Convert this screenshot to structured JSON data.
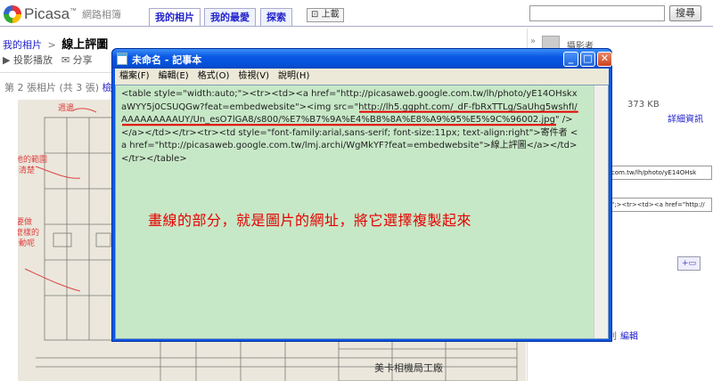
{
  "header": {
    "logo_text": "Picasa",
    "logo_tm": "™",
    "logo_sub": "網路相簿",
    "tabs": [
      "我的相片",
      "我的最愛",
      "探索"
    ],
    "upload_label": "上載",
    "search_placeholder": "",
    "search_button": "搜尋"
  },
  "breadcrumb": {
    "link": "我的相片",
    "separator": ">",
    "title": "線上評圖"
  },
  "toolbar": {
    "slideshow": "▶ 投影播放",
    "share": "✉ 分享"
  },
  "photo_counter": {
    "text": "第 2 張相片 (共 3 張)",
    "link": "檢"
  },
  "sidebar": {
    "collapse": "»",
    "photographer_label": "攝影者",
    "filesize": "373 KB",
    "details_link": "詳細資訊",
    "embed_value_1": "com.tw/lh/photo/yE14OHsk",
    "embed_value_2": "\";><tr><td><a href=\"http://",
    "add_tag": "+",
    "tag_edit_prefix": "利",
    "tag_edit_link": "編輯"
  },
  "notepad": {
    "title": "未命名 - 記事本",
    "menu": [
      "檔案(F)",
      "編輯(E)",
      "格式(O)",
      "檢視(V)",
      "說明(H)"
    ],
    "content_before": "<table style=\"width:auto;\"><tr><td><a href=\"http://picasaweb.google.com.tw/lh/photo/yE14OHskxaWYY5j0CSUQGw?feat=embedwebsite\"><img src=\"",
    "url_highlight": "http://lh5.ggpht.com/_dF-fbRxTTLg/SaUhg5wshfI/AAAAAAAAAUY/Un_esO7lGA8/s800/%E7%B7%9A%E4%B8%8A%E8%A9%95%E5%9C%96002.jpg",
    "content_after": "\" /></a></td></tr><tr><td style=\"font-family:arial,sans-serif; font-size:11px; text-align:right\">寄件者 <a href=\"http://picasaweb.google.com.tw/lmj.archi/WgMkYF?feat=embedwebsite\">線上評圖</a></td></tr></table>",
    "annotation": "畫線的部分，就是圖片的網址，將它選擇複製起來"
  },
  "colors": {
    "annotation_red": "#e60000",
    "notepad_bg": "#c7e8c7",
    "xp_blue": "#0a58e4",
    "link_blue": "#2222cc"
  }
}
